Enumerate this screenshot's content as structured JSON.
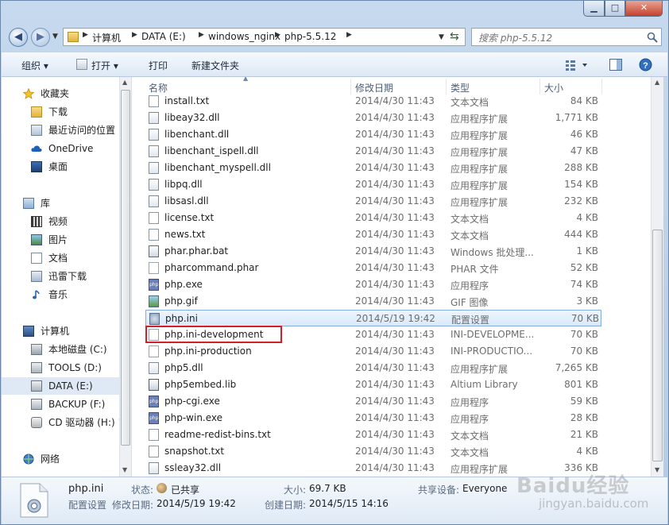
{
  "window": {
    "minimize_glyph": "▁",
    "maximize_glyph": "□",
    "close_glyph": "✕"
  },
  "address_bar": {
    "breadcrumbs": [
      "计算机",
      "DATA (E:)",
      "windows_nginx",
      "php-5.5.12"
    ],
    "refresh_glyph": "⇆"
  },
  "search": {
    "placeholder": "搜索 php-5.5.12"
  },
  "toolbar": {
    "organize": "组织 ▾",
    "open": "打开 ▾",
    "print": "打印",
    "new_folder": "新建文件夹"
  },
  "sidebar": {
    "favorites": {
      "label": "收藏夹",
      "items": [
        "下载",
        "最近访问的位置",
        "OneDrive",
        "桌面"
      ]
    },
    "libraries": {
      "label": "库",
      "items": [
        "视频",
        "图片",
        "文档",
        "迅雷下载",
        "音乐"
      ]
    },
    "computer": {
      "label": "计算机",
      "items": [
        "本地磁盘 (C:)",
        "TOOLS (D:)",
        "DATA (E:)",
        "BACKUP (F:)",
        "CD 驱动器 (H:) 1"
      ]
    },
    "network": {
      "label": "网络"
    }
  },
  "columns": {
    "name": "名称",
    "modified": "修改日期",
    "type": "类型",
    "size": "大小"
  },
  "files": [
    {
      "name": "install.txt",
      "date": "2014/4/30 11:43",
      "type": "文本文档",
      "size": "84 KB",
      "icon": "text-file-icon"
    },
    {
      "name": "libeay32.dll",
      "date": "2014/4/30 11:43",
      "type": "应用程序扩展",
      "size": "1,771 KB",
      "icon": "dll-file-icon"
    },
    {
      "name": "libenchant.dll",
      "date": "2014/4/30 11:43",
      "type": "应用程序扩展",
      "size": "46 KB",
      "icon": "dll-file-icon"
    },
    {
      "name": "libenchant_ispell.dll",
      "date": "2014/4/30 11:43",
      "type": "应用程序扩展",
      "size": "47 KB",
      "icon": "dll-file-icon"
    },
    {
      "name": "libenchant_myspell.dll",
      "date": "2014/4/30 11:43",
      "type": "应用程序扩展",
      "size": "288 KB",
      "icon": "dll-file-icon"
    },
    {
      "name": "libpq.dll",
      "date": "2014/4/30 11:43",
      "type": "应用程序扩展",
      "size": "154 KB",
      "icon": "dll-file-icon"
    },
    {
      "name": "libsasl.dll",
      "date": "2014/4/30 11:43",
      "type": "应用程序扩展",
      "size": "232 KB",
      "icon": "dll-file-icon"
    },
    {
      "name": "license.txt",
      "date": "2014/4/30 11:43",
      "type": "文本文档",
      "size": "4 KB",
      "icon": "text-file-icon"
    },
    {
      "name": "news.txt",
      "date": "2014/4/30 11:43",
      "type": "文本文档",
      "size": "444 KB",
      "icon": "text-file-icon"
    },
    {
      "name": "phar.phar.bat",
      "date": "2014/4/30 11:43",
      "type": "Windows 批处理...",
      "size": "1 KB",
      "icon": "batch-file-icon"
    },
    {
      "name": "pharcommand.phar",
      "date": "2014/4/30 11:43",
      "type": "PHAR 文件",
      "size": "52 KB",
      "icon": "blank-file-icon"
    },
    {
      "name": "php.exe",
      "date": "2014/4/30 11:43",
      "type": "应用程序",
      "size": "74 KB",
      "icon": "php-exe-icon"
    },
    {
      "name": "php.gif",
      "date": "2014/4/30 11:43",
      "type": "GIF 图像",
      "size": "3 KB",
      "icon": "image-file-icon"
    },
    {
      "name": "php.ini",
      "date": "2014/5/19 19:42",
      "type": "配置设置",
      "size": "70 KB",
      "icon": "config-file-icon",
      "selected": true
    },
    {
      "name": "php.ini-development",
      "date": "2014/4/30 11:43",
      "type": "INI-DEVELOPME...",
      "size": "70 KB",
      "icon": "blank-file-icon",
      "highlighted": true
    },
    {
      "name": "php.ini-production",
      "date": "2014/4/30 11:43",
      "type": "INI-PRODUCTIO...",
      "size": "70 KB",
      "icon": "blank-file-icon"
    },
    {
      "name": "php5.dll",
      "date": "2014/4/30 11:43",
      "type": "应用程序扩展",
      "size": "7,265 KB",
      "icon": "dll-file-icon"
    },
    {
      "name": "php5embed.lib",
      "date": "2014/4/30 11:43",
      "type": "Altium Library",
      "size": "801 KB",
      "icon": "library-file-icon"
    },
    {
      "name": "php-cgi.exe",
      "date": "2014/4/30 11:43",
      "type": "应用程序",
      "size": "59 KB",
      "icon": "php-exe-icon"
    },
    {
      "name": "php-win.exe",
      "date": "2014/4/30 11:43",
      "type": "应用程序",
      "size": "28 KB",
      "icon": "php-exe-icon"
    },
    {
      "name": "readme-redist-bins.txt",
      "date": "2014/4/30 11:43",
      "type": "文本文档",
      "size": "21 KB",
      "icon": "text-file-icon"
    },
    {
      "name": "snapshot.txt",
      "date": "2014/4/30 11:43",
      "type": "文本文档",
      "size": "4 KB",
      "icon": "text-file-icon"
    },
    {
      "name": "ssleay32.dll",
      "date": "2014/4/30 11:43",
      "type": "应用程序扩展",
      "size": "336 KB",
      "icon": "dll-file-icon"
    }
  ],
  "details": {
    "filename": "php.ini",
    "filetype": "配置设置",
    "status_label": "状态:",
    "status_value": "已共享",
    "modified_label": "修改日期:",
    "modified_value": "2014/5/19 19:42",
    "size_label": "大小:",
    "size_value": "69.7 KB",
    "created_label": "创建日期:",
    "created_value": "2014/5/15 14:16",
    "shared_label": "共享设备:",
    "shared_value": "Everyone"
  },
  "watermark": {
    "brand": "Baidu经验",
    "url": "jingyan.baidu.com"
  },
  "colors": {
    "highlight_box": "#d0202a",
    "selection_border": "#84acdd"
  }
}
